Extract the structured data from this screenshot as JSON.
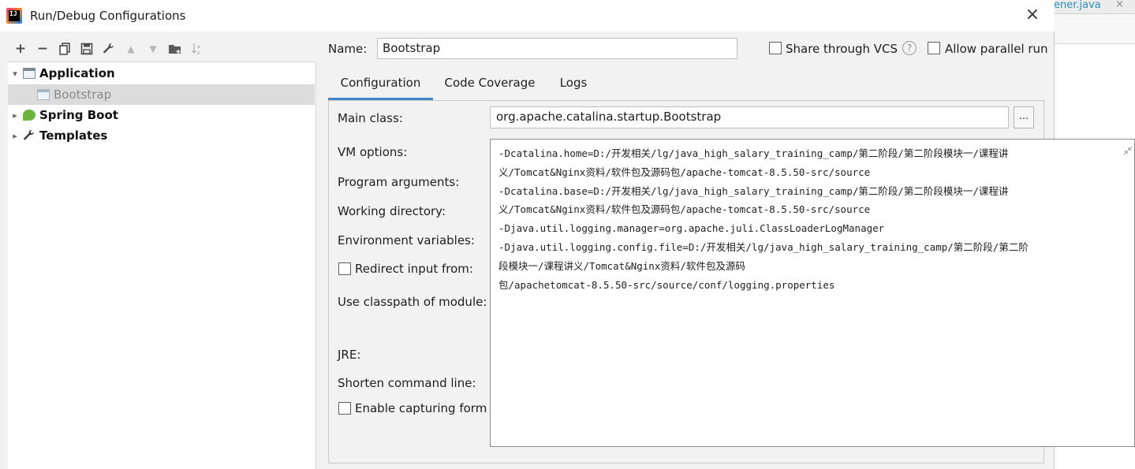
{
  "window": {
    "title": "Run/Debug Configurations",
    "close": "×"
  },
  "background": {
    "tab_text": "ener.java",
    "tab_close": "×"
  },
  "toolbar": {
    "add": "+",
    "remove": "−",
    "copy": "⧉",
    "save": "🖫",
    "edit": "🔧",
    "move_up": "▲",
    "move_down": "▼",
    "folder": "📁",
    "sort": "↓ᶻ"
  },
  "tree": {
    "application": {
      "label": "Application",
      "arrow": "▾"
    },
    "bootstrap": {
      "label": "Bootstrap"
    },
    "spring_boot": {
      "label": "Spring Boot",
      "arrow": "▸"
    },
    "templates": {
      "label": "Templates",
      "arrow": "▸"
    }
  },
  "form": {
    "name_label": "Name:",
    "name_value": "Bootstrap",
    "share_vcs": "Share through VCS",
    "help": "?",
    "allow_parallel": "Allow parallel run",
    "tabs": [
      "Configuration",
      "Code Coverage",
      "Logs"
    ],
    "main_class_label": "Main class:",
    "main_class_value": "org.apache.catalina.startup.Bootstrap",
    "browse": "...",
    "vm_options_label": "VM options:",
    "program_args_label": "Program arguments:",
    "working_dir_label": "Working directory:",
    "env_vars_label": "Environment variables:",
    "redirect_input_label": "Redirect input from:",
    "classpath_label": "Use classpath of module:",
    "jre_label": "JRE:",
    "shorten_label": "Shorten command line:",
    "capture_label": "Enable capturing form s",
    "vm_options_lines": [
      "-Dcatalina.home=D:/开发相关/lg/java_high_salary_training_camp/第二阶段/第二阶段模块一/课程讲",
      "义/Tomcat&Nginx资料/软件包及源码包/apache-tomcat-8.5.50-src/source",
      "-Dcatalina.base=D:/开发相关/lg/java_high_salary_training_camp/第二阶段/第二阶段模块一/课程讲",
      "义/Tomcat&Nginx资料/软件包及源码包/apache-tomcat-8.5.50-src/source",
      "-Djava.util.logging.manager=org.apache.juli.ClassLoaderLogManager",
      "-Djava.util.logging.config.file=D:/开发相关/lg/java_high_salary_training_camp/第二阶段/第二阶",
      "段模块一/课程讲义/Tomcat&Nginx资料/软件包及源码",
      "包/apachetomcat-8.5.50-src/source/conf/logging.properties"
    ]
  }
}
